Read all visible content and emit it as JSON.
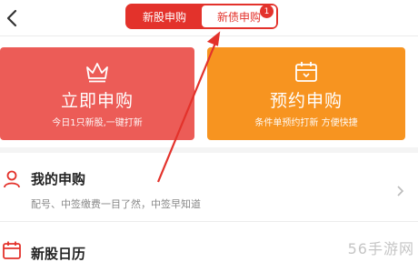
{
  "header": {
    "tabs": [
      {
        "label": "新股申购",
        "active": false
      },
      {
        "label": "新债申购",
        "active": true
      }
    ],
    "badge_count": "1"
  },
  "cards": {
    "subscribe": {
      "title": "立即申购",
      "subtitle": "今日1只新股,一键打新",
      "color": "#ec5c57",
      "icon": "crown-icon"
    },
    "reserve": {
      "title": "预约申购",
      "subtitle": "条件单预约打新 方便快捷",
      "color": "#f79420",
      "icon": "calendar-icon"
    }
  },
  "list": {
    "my_subscription": {
      "title": "我的申购",
      "subtitle": "配号、中签缴费一目了然，中签早知道",
      "icon": "user-icon"
    },
    "ipo_calendar": {
      "title": "新股日历",
      "icon": "calendar-icon"
    }
  },
  "watermark": "56手游网",
  "colors": {
    "accent": "#e3322b",
    "red_card": "#ec5c57",
    "orange_card": "#f79420"
  }
}
